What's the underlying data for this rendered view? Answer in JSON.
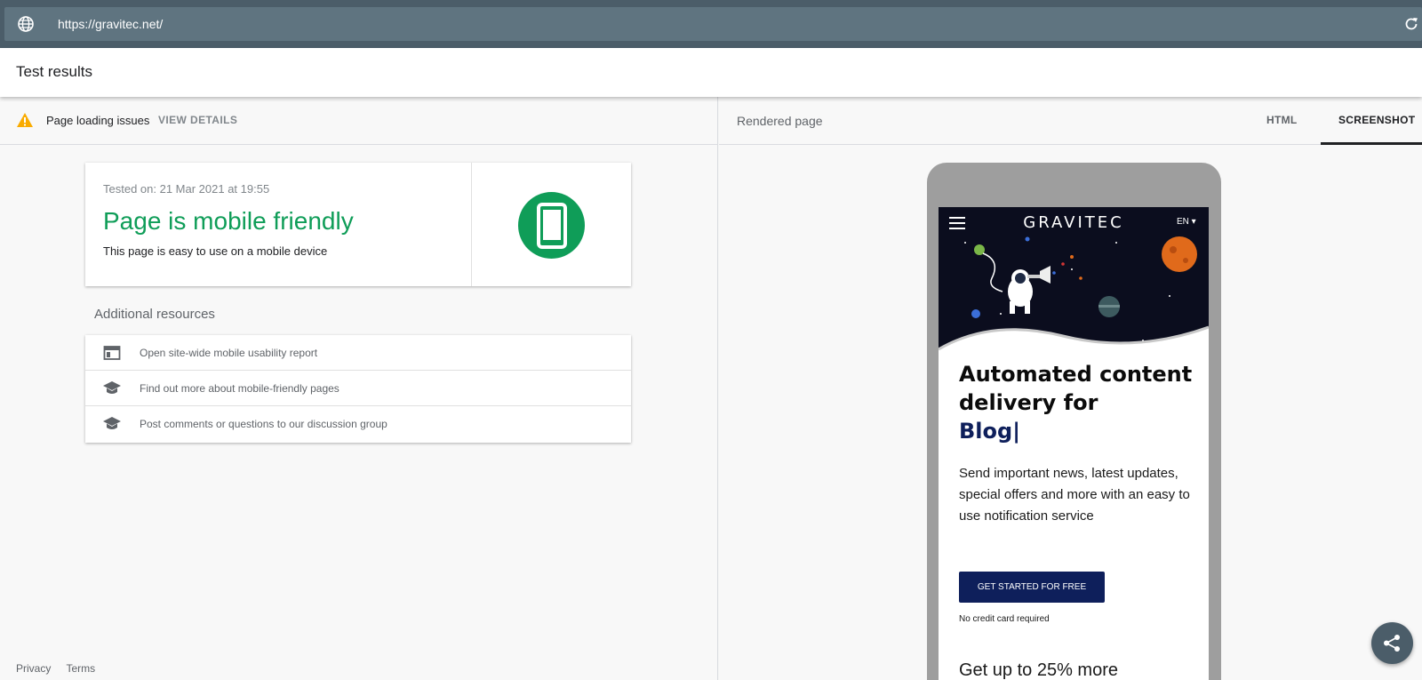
{
  "urlbar": {
    "url": "https://gravitec.net/",
    "globe_icon": "globe-icon",
    "reload_icon": "reload-icon"
  },
  "header": {
    "title": "Test results"
  },
  "issues": {
    "text": "Page loading issues",
    "action": "VIEW DETAILS",
    "icon": "warning-icon",
    "icon_color": "#f9ab00"
  },
  "result": {
    "tested_on": "Tested on: 21 Mar 2021 at 19:55",
    "heading": "Page is mobile friendly",
    "description": "This page is easy to use on a mobile device",
    "accent": "#0f9d58",
    "icon": "mobile-phone-icon"
  },
  "resources": {
    "title": "Additional resources",
    "items": [
      {
        "label": "Open site-wide mobile usability report",
        "icon": "report-icon"
      },
      {
        "label": "Find out more about mobile-friendly pages",
        "icon": "school-icon"
      },
      {
        "label": "Post comments or questions to our discussion group",
        "icon": "school-icon"
      }
    ]
  },
  "footer": {
    "privacy": "Privacy",
    "terms": "Terms"
  },
  "rendered": {
    "title": "Rendered page",
    "tabs": [
      "HTML",
      "SCREENSHOT"
    ],
    "active_tab": "SCREENSHOT"
  },
  "site": {
    "brand": "GRAVITEC",
    "lang": "EN ▾",
    "headline_1": "Automated content delivery for",
    "headline_2": "Blog|",
    "paragraph": "Send important news, latest updates, special offers and more with an easy to use notification service",
    "cta": "GET STARTED FOR FREE",
    "note": "No credit card required",
    "next_heading": "Get up to 25% more",
    "brand_color": "#0e1f5b"
  },
  "share": {
    "icon": "share-icon"
  }
}
